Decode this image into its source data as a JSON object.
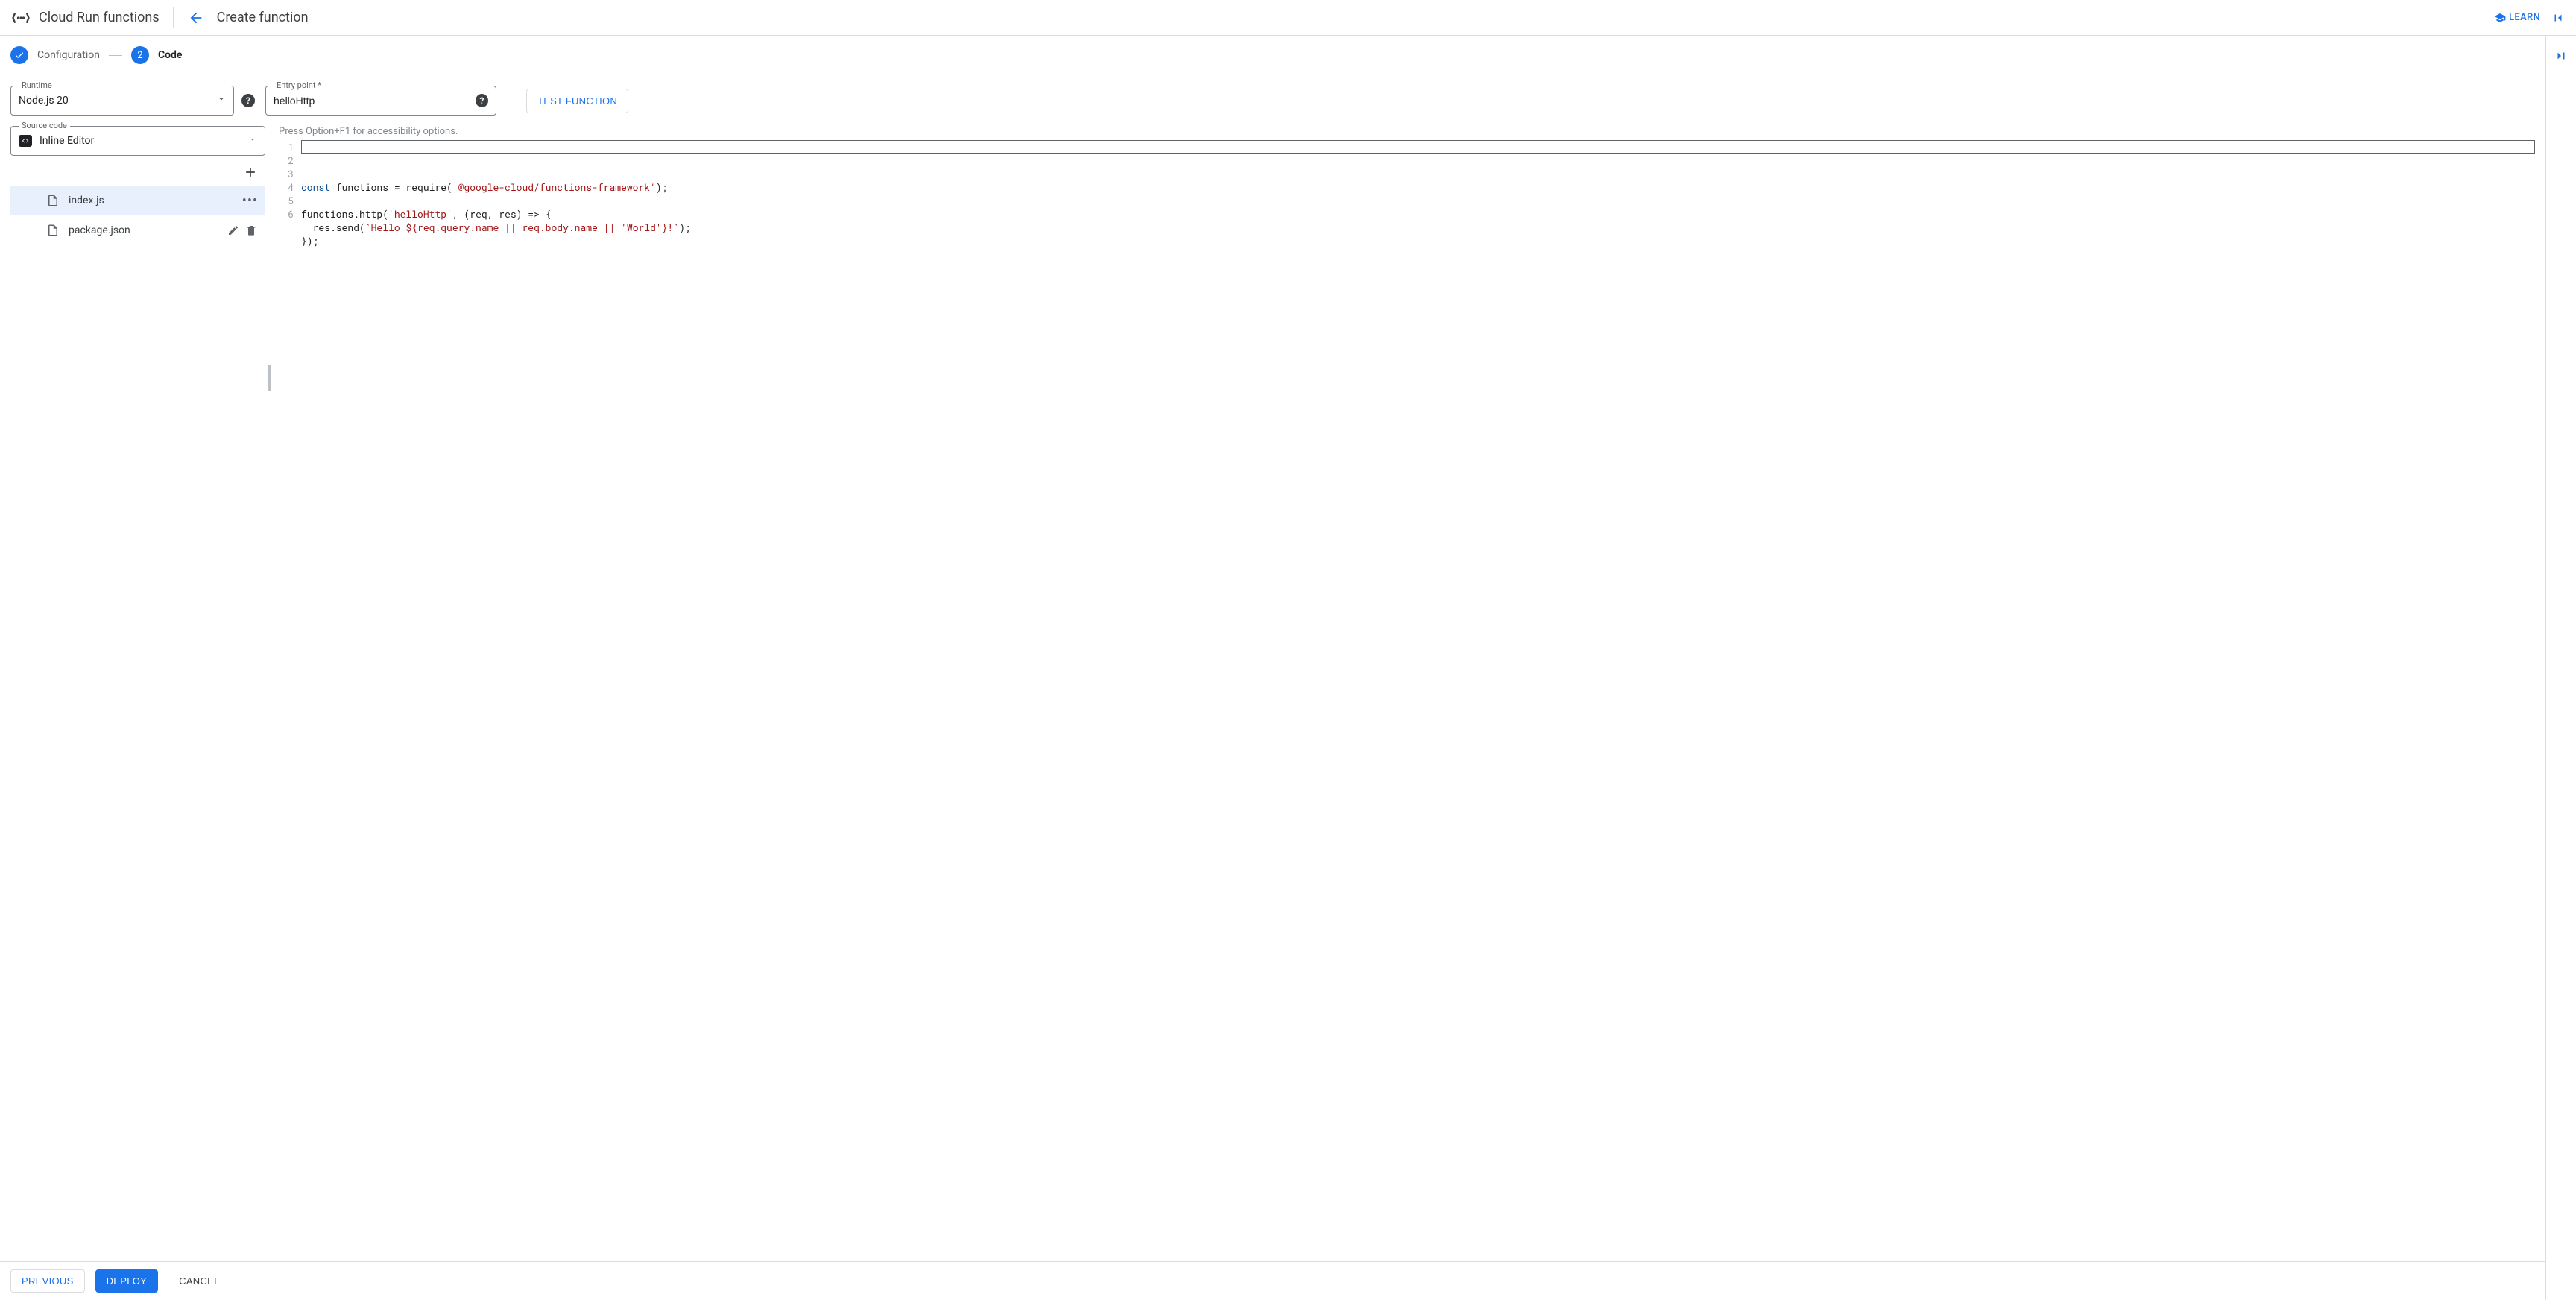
{
  "header": {
    "product": "Cloud Run functions",
    "page_title": "Create function",
    "learn_label": "LEARN"
  },
  "stepper": {
    "step1_label": "Configuration",
    "step2_number": "2",
    "step2_label": "Code"
  },
  "fields": {
    "runtime_label": "Runtime",
    "runtime_value": "Node.js 20",
    "entry_label": "Entry point *",
    "entry_value": "helloHttp",
    "source_label": "Source code",
    "source_value": "Inline Editor"
  },
  "actions": {
    "test_function": "TEST FUNCTION",
    "previous": "PREVIOUS",
    "deploy": "DEPLOY",
    "cancel": "CANCEL"
  },
  "files": [
    {
      "name": "index.js",
      "selected": true,
      "menu": "kebab"
    },
    {
      "name": "package.json",
      "selected": false,
      "menu": "edit-delete"
    }
  ],
  "editor": {
    "a11y_hint": "Press Option+F1 for accessibility options.",
    "lines": [
      {
        "tokens": [
          {
            "t": "const",
            "c": "tok-kw"
          },
          {
            "t": " functions = require(",
            "c": "tok-pun"
          },
          {
            "t": "'@google-cloud/functions-framework'",
            "c": "tok-str"
          },
          {
            "t": ");",
            "c": "tok-pun"
          }
        ]
      },
      {
        "tokens": []
      },
      {
        "tokens": [
          {
            "t": "functions.http(",
            "c": "tok-pun"
          },
          {
            "t": "'helloHttp'",
            "c": "tok-str"
          },
          {
            "t": ", (req, res) => {",
            "c": "tok-pun"
          }
        ]
      },
      {
        "tokens": [
          {
            "t": "  res.send(",
            "c": "tok-pun"
          },
          {
            "t": "`Hello ${req.query.name || req.body.name || ",
            "c": "tok-str"
          },
          {
            "t": "'World'",
            "c": "tok-str"
          },
          {
            "t": "}!`",
            "c": "tok-str"
          },
          {
            "t": ");",
            "c": "tok-pun"
          }
        ]
      },
      {
        "tokens": [
          {
            "t": "});",
            "c": "tok-pun"
          }
        ]
      },
      {
        "tokens": []
      }
    ]
  }
}
